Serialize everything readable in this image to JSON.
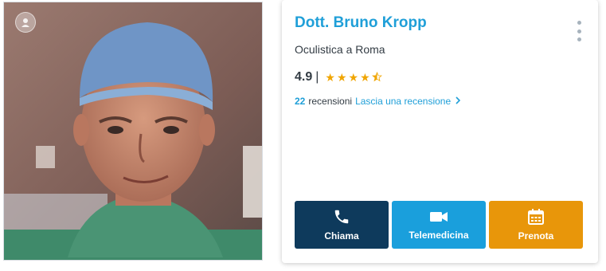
{
  "doctor": {
    "name": "Dott. Bruno Kropp",
    "specialty": "Oculistica a Roma",
    "rating": "4.9",
    "rating_separator": "|",
    "stars": 4.5,
    "reviews_count": "22",
    "reviews_label": "recensioni",
    "review_link_label": "Lascia una recensione"
  },
  "icons": {
    "badge": "doctor-badge-icon",
    "menu": "kebab-menu-icon",
    "call": "phone-icon",
    "video": "video-camera-icon",
    "book": "calendar-icon",
    "chevron": "chevron-right-icon"
  },
  "actions": {
    "call_label": "Chiama",
    "telemedicine_label": "Telemedicina",
    "book_label": "Prenota"
  },
  "colors": {
    "accent": "#1f9fd8",
    "call_button": "#0e3a5c",
    "telemedicine_button": "#1a9fdc",
    "book_button": "#e8960a",
    "star": "#f0a500"
  }
}
